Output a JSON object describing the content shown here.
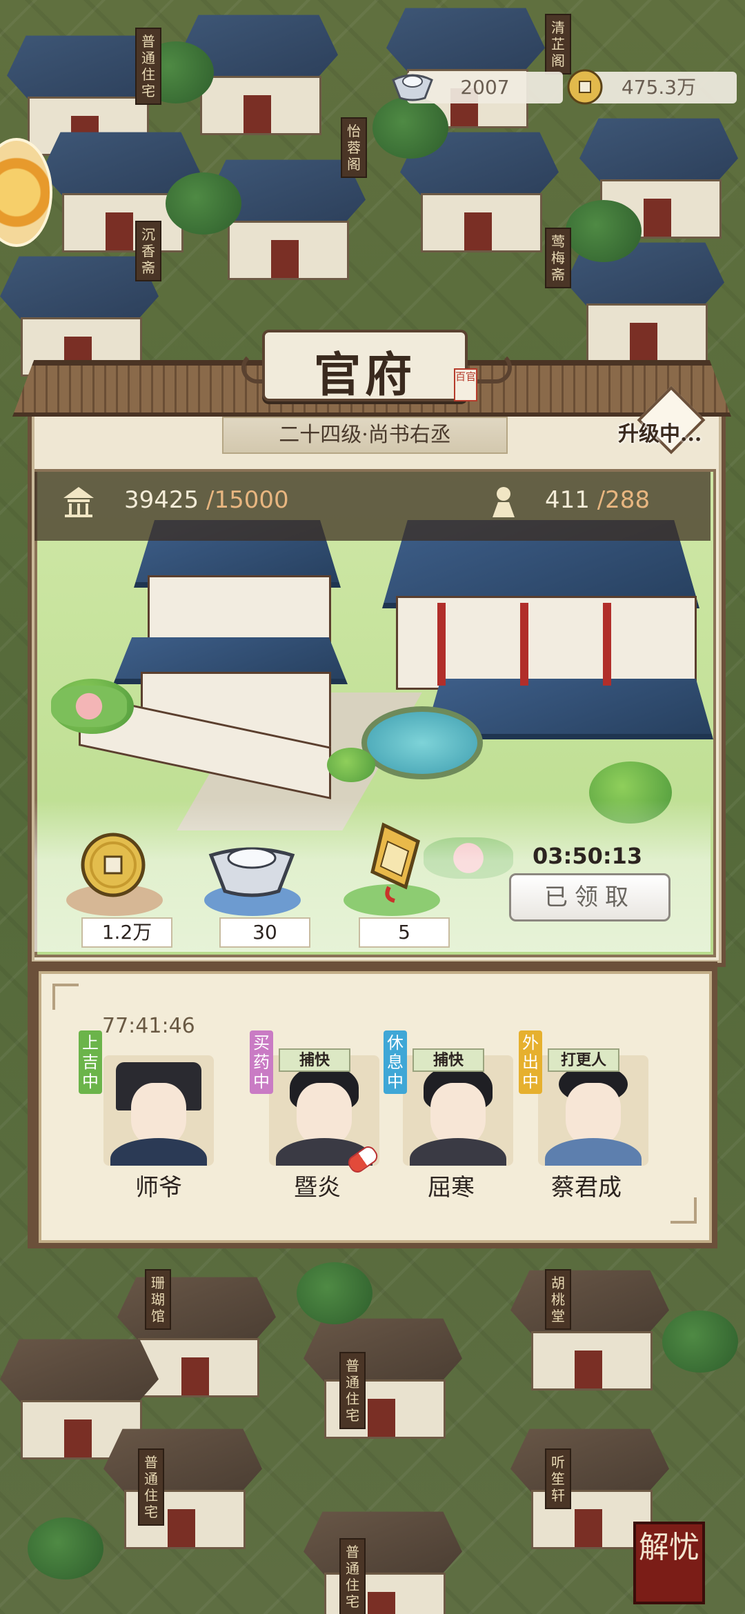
{
  "currency": {
    "silver": "2007",
    "coins": "475.3万"
  },
  "signs": {
    "top_left": "普通住宅",
    "mid_left_1": "怡蓉阁",
    "mid_left_2": "沉香斋",
    "top_right_1": "清芷阁",
    "top_right_2": "莺梅斋",
    "bottom_1": "珊瑚馆",
    "bottom_2": "胡桃堂",
    "bottom_3": "普通住宅",
    "bottom_4": "普通住宅",
    "bottom_5": "听笙轩",
    "bottom_6": "普通住宅"
  },
  "office": {
    "title": "官府",
    "seal": "百官",
    "rank": "二十四级·尚书右丞",
    "upgrade_status": "升级中...",
    "stat1_value": "39425",
    "stat1_max": "/15000",
    "stat2_value": "411",
    "stat2_max": "/288",
    "rewards": [
      {
        "icon": "copper-coin-icon",
        "amount": "1.2万"
      },
      {
        "icon": "silver-ingot-icon",
        "amount": "30"
      },
      {
        "icon": "token-tablet-icon",
        "amount": "5"
      }
    ],
    "timer": "03:50:13",
    "claim_button": "已领取"
  },
  "staff": {
    "timer": "77:41:46",
    "members": [
      {
        "name": "师爷",
        "status": "上吉中",
        "status_color": "#6bb44a",
        "role": ""
      },
      {
        "name": "暨炎",
        "status": "买药中",
        "status_color": "#c97bc4",
        "role": "捕快"
      },
      {
        "name": "屈寒",
        "status": "休息中",
        "status_color": "#3fa7d6",
        "role": "捕快"
      },
      {
        "name": "蔡君成",
        "status": "外出中",
        "status_color": "#e6b02e",
        "role": "打更人"
      }
    ]
  },
  "corner_button": "解忧"
}
